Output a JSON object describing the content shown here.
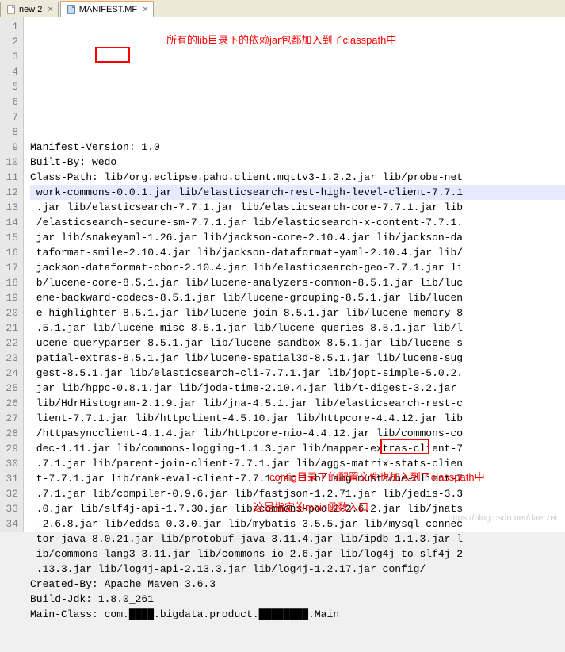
{
  "tabs": {
    "inactive": {
      "label": "new 2"
    },
    "active": {
      "label": "MANIFEST.MF"
    }
  },
  "annotations": {
    "top": "所有的lib目录下的依赖jar包都加入到了classpath中",
    "config": "config目录下的配置文件也加入到了classpath中",
    "main": "这是指定的main函数入口"
  },
  "watermark": "https://blog.csdn.net/daerzei",
  "lines": [
    "Manifest-Version: 1.0",
    "Built-By: wedo",
    "Class-Path: lib/org.eclipse.paho.client.mqttv3-1.2.2.jar lib/probe-net",
    " work-commons-0.0.1.jar lib/elasticsearch-rest-high-level-client-7.7.1",
    " .jar lib/elasticsearch-7.7.1.jar lib/elasticsearch-core-7.7.1.jar lib",
    " /elasticsearch-secure-sm-7.7.1.jar lib/elasticsearch-x-content-7.7.1.",
    " jar lib/snakeyaml-1.26.jar lib/jackson-core-2.10.4.jar lib/jackson-da",
    " taformat-smile-2.10.4.jar lib/jackson-dataformat-yaml-2.10.4.jar lib/",
    " jackson-dataformat-cbor-2.10.4.jar lib/elasticsearch-geo-7.7.1.jar li",
    " b/lucene-core-8.5.1.jar lib/lucene-analyzers-common-8.5.1.jar lib/luc",
    " ene-backward-codecs-8.5.1.jar lib/lucene-grouping-8.5.1.jar lib/lucen",
    " e-highlighter-8.5.1.jar lib/lucene-join-8.5.1.jar lib/lucene-memory-8",
    " .5.1.jar lib/lucene-misc-8.5.1.jar lib/lucene-queries-8.5.1.jar lib/l",
    " ucene-queryparser-8.5.1.jar lib/lucene-sandbox-8.5.1.jar lib/lucene-s",
    " patial-extras-8.5.1.jar lib/lucene-spatial3d-8.5.1.jar lib/lucene-sug",
    " gest-8.5.1.jar lib/elasticsearch-cli-7.7.1.jar lib/jopt-simple-5.0.2.",
    " jar lib/hppc-0.8.1.jar lib/joda-time-2.10.4.jar lib/t-digest-3.2.jar ",
    " lib/HdrHistogram-2.1.9.jar lib/jna-4.5.1.jar lib/elasticsearch-rest-c",
    " lient-7.7.1.jar lib/httpclient-4.5.10.jar lib/httpcore-4.4.12.jar lib",
    " /httpasyncclient-4.1.4.jar lib/httpcore-nio-4.4.12.jar lib/commons-co",
    " dec-1.11.jar lib/commons-logging-1.1.3.jar lib/mapper-extras-client-7",
    " .7.1.jar lib/parent-join-client-7.7.1.jar lib/aggs-matrix-stats-clien",
    " t-7.7.1.jar lib/rank-eval-client-7.7.1.jar lib/lang-mustache-client-7",
    " .7.1.jar lib/compiler-0.9.6.jar lib/fastjson-1.2.71.jar lib/jedis-3.3",
    " .0.jar lib/slf4j-api-1.7.30.jar lib/commons-pool2-2.6.2.jar lib/jnats",
    " -2.6.8.jar lib/eddsa-0.3.0.jar lib/mybatis-3.5.5.jar lib/mysql-connec",
    " tor-java-8.0.21.jar lib/protobuf-java-3.11.4.jar lib/ipdb-1.1.3.jar l",
    " ib/commons-lang3-3.11.jar lib/commons-io-2.6.jar lib/log4j-to-slf4j-2",
    " .13.3.jar lib/log4j-api-2.13.3.jar lib/log4j-1.2.17.jar config/",
    "Created-By: Apache Maven 3.6.3",
    "Build-Jdk: 1.8.0_261",
    "Main-Class: com.████.bigdata.product.████████.Main",
    "",
    ""
  ],
  "line_numbers": [
    "1",
    "2",
    "3",
    "4",
    "5",
    "6",
    "7",
    "8",
    "9",
    "10",
    "11",
    "12",
    "13",
    "14",
    "15",
    "16",
    "17",
    "18",
    "19",
    "20",
    "21",
    "22",
    "23",
    "24",
    "25",
    "26",
    "27",
    "28",
    "29",
    "30",
    "31",
    "32",
    "33",
    "34"
  ],
  "current_line": 4
}
